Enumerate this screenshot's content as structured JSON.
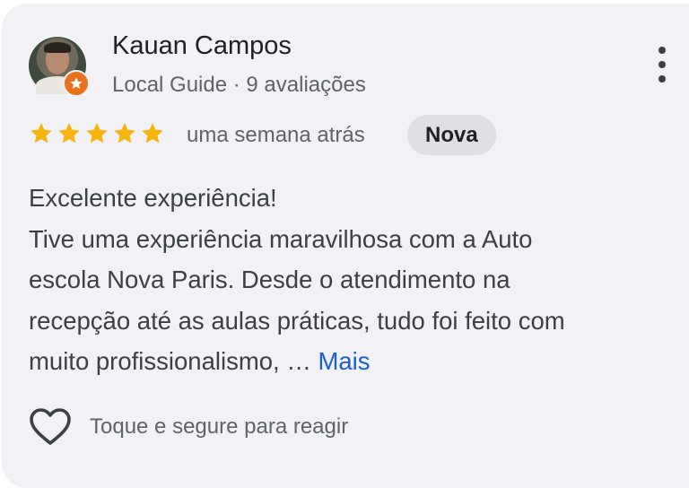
{
  "reviewer": {
    "name": "Kauan Campos",
    "subtitle": "Local Guide · 9 avaliações"
  },
  "rating": {
    "stars": 5,
    "max_stars": 5,
    "when": "uma semana atrás",
    "badge": "Nova"
  },
  "review": {
    "lines": [
      "Excelente experiência!",
      "Tive uma experiência maravilhosa com a Auto",
      "escola Nova Paris. Desde o atendimento na",
      "recepção até as aulas práticas, tudo foi feito com",
      "muito profissionalismo, …"
    ],
    "more_label": "Mais"
  },
  "reaction": {
    "label": "Toque e segure para reagir"
  },
  "colors": {
    "card_background": "#f2f2f6",
    "star": "#f6b40e",
    "link": "#1a5fd0",
    "guide_badge": "#e8731f"
  },
  "icons": {
    "menu": "more-vert-icon",
    "star": "star-icon",
    "reaction": "heart-outline-icon",
    "guide": "local-guide-star-icon"
  }
}
